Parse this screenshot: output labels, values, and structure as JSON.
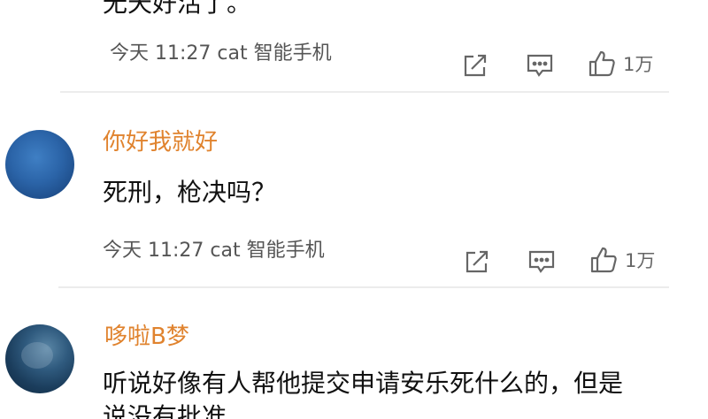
{
  "comments": [
    {
      "username": "",
      "content": "无天好活了。",
      "time": "今天 11:27",
      "device": "cat 智能手机",
      "likes": "1万"
    },
    {
      "username": "你好我就好",
      "content": "死刑，枪决吗？",
      "time": "今天 11:27",
      "device": "cat 智能手机",
      "likes": "1万"
    },
    {
      "username": "哆啦B梦",
      "content_lines": [
        "听说好像有人帮他提交申请安乐死什么的，但是",
        "说没有批准。"
      ]
    }
  ],
  "icons": {
    "share": "share-icon",
    "comment": "comment-icon",
    "like": "thumbs-up-icon"
  },
  "colors": {
    "username": "#e0832e",
    "meta": "#555555",
    "divider": "#ececec"
  }
}
